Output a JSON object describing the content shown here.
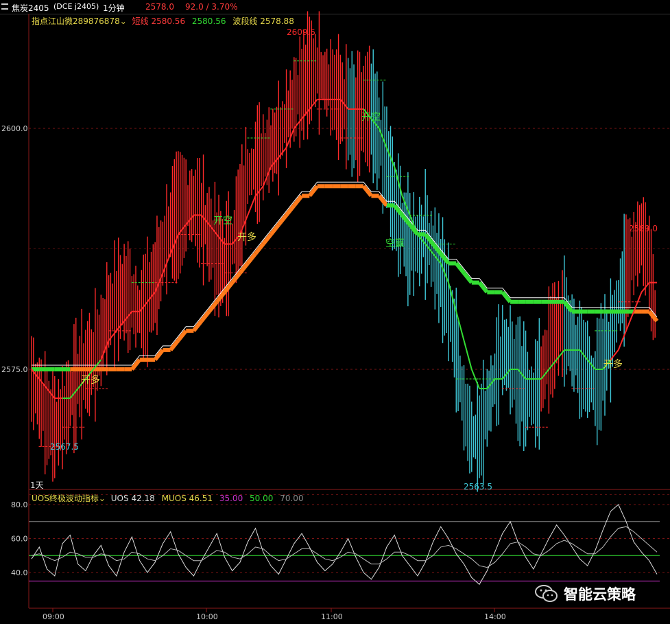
{
  "topbar": {
    "symbol": "焦炭2405",
    "symbol_code": "(DCE j2405)",
    "period": "1分钟",
    "last_price": "2578.0",
    "change": "92.0 / 3.70%"
  },
  "main_legend": {
    "indicator": "指点江山微289876878",
    "short_label": "短线",
    "short_value": "2580.56",
    "mid_value": "2580.56",
    "wave_label": "波段线",
    "wave_value": "2578.88"
  },
  "sub_legend": {
    "indicator": "UOS终极波动指标",
    "uos_label": "UOS",
    "uos_value": "42.18",
    "muos_label": "MUOS",
    "muos_value": "46.51",
    "lvl1": "35.00",
    "lvl2": "50.00",
    "lvl3": "70.00"
  },
  "period_mark": "1天",
  "watermark": "智能云策略",
  "colors": {
    "up": "#ff2a2a",
    "down": "#3fc8d8",
    "green": "#33dd33",
    "orange": "#ff7a1a",
    "white": "#ffffff",
    "grid": "#8b1a1a",
    "magenta": "#cc33cc",
    "yellow": "#e6d84a"
  },
  "signals": [
    {
      "label": "开多",
      "side": "long"
    },
    {
      "label": "开空",
      "side": "short"
    },
    {
      "label": "开多",
      "side": "long"
    },
    {
      "label": "开空",
      "side": "short"
    },
    {
      "label": "空赢",
      "side": "short"
    },
    {
      "label": "开多",
      "side": "long"
    }
  ],
  "chart_data": [
    {
      "type": "line",
      "title": "焦炭2405 1分钟",
      "xlabel": "",
      "ylabel": "",
      "x_ticks": [
        "09:00",
        "10:00",
        "11:00",
        "14:00"
      ],
      "y_ticks": [
        2575.0,
        2600.0
      ],
      "ylim": [
        2560,
        2612
      ],
      "annotations": {
        "high": "2609.5",
        "low": "2563.5",
        "left_low": "2567.5",
        "right_high": "2589.0"
      },
      "series": [
        {
          "name": "price_close",
          "values": [
            2574,
            2572,
            2570,
            2569,
            2570,
            2572,
            2574,
            2575,
            2576,
            2578,
            2581,
            2582,
            2583,
            2582,
            2581,
            2582,
            2584,
            2587,
            2590,
            2591,
            2592,
            2592,
            2591,
            2589,
            2587,
            2586,
            2588,
            2591,
            2595,
            2596,
            2597,
            2598,
            2599,
            2601,
            2603,
            2604,
            2606,
            2606,
            2605,
            2604,
            2603,
            2602,
            2601,
            2602,
            2602,
            2599,
            2597,
            2592,
            2590,
            2588,
            2588,
            2589,
            2587,
            2585,
            2582,
            2577,
            2571,
            2568,
            2568,
            2571,
            2574,
            2577,
            2576,
            2574,
            2573,
            2572,
            2574,
            2577,
            2579,
            2580,
            2578,
            2576,
            2575,
            2573,
            2576,
            2578,
            2582,
            2585,
            2587,
            2589,
            2586,
            2579
          ]
        },
        {
          "name": "短线",
          "values": [
            2575,
            2574,
            2573,
            2572,
            2572,
            2572,
            2573,
            2574,
            2575,
            2576,
            2578,
            2579,
            2580,
            2581,
            2581,
            2582,
            2583,
            2585,
            2587,
            2589,
            2590,
            2591,
            2591,
            2590,
            2589,
            2588,
            2588,
            2589,
            2591,
            2593,
            2594,
            2596,
            2597,
            2598,
            2600,
            2601,
            2602,
            2603,
            2603,
            2603,
            2603,
            2602,
            2602,
            2602,
            2601,
            2600,
            2598,
            2596,
            2593,
            2591,
            2589,
            2588,
            2587,
            2586,
            2584,
            2581,
            2578,
            2575,
            2573,
            2573,
            2574,
            2574,
            2575,
            2575,
            2574,
            2574,
            2574,
            2575,
            2576,
            2577,
            2577,
            2577,
            2576,
            2575,
            2575,
            2576,
            2577,
            2579,
            2581,
            2583,
            2584,
            2584
          ]
        },
        {
          "name": "波段线",
          "values": [
            2575,
            2575,
            2575,
            2575,
            2575,
            2575,
            2575,
            2575,
            2575,
            2575,
            2575,
            2575,
            2575,
            2575,
            2576,
            2576,
            2576,
            2577,
            2577,
            2578,
            2579,
            2579,
            2580,
            2581,
            2582,
            2583,
            2584,
            2585,
            2586,
            2587,
            2588,
            2589,
            2590,
            2591,
            2592,
            2593,
            2593,
            2594,
            2594,
            2594,
            2594,
            2594,
            2594,
            2594,
            2593,
            2593,
            2592,
            2592,
            2591,
            2590,
            2589,
            2589,
            2588,
            2587,
            2586,
            2586,
            2585,
            2584,
            2584,
            2583,
            2583,
            2583,
            2582,
            2582,
            2582,
            2582,
            2582,
            2582,
            2582,
            2582,
            2581,
            2581,
            2581,
            2581,
            2581,
            2581,
            2581,
            2581,
            2581,
            2581,
            2581,
            2580
          ]
        }
      ]
    },
    {
      "type": "line",
      "title": "UOS终极波动指标",
      "y_ticks": [
        40.0,
        60.0,
        80.0
      ],
      "ylim": [
        20,
        82
      ],
      "reference_lines": [
        35,
        50,
        70
      ],
      "series": [
        {
          "name": "UOS",
          "values": [
            48,
            55,
            42,
            38,
            57,
            62,
            45,
            41,
            50,
            56,
            44,
            38,
            52,
            61,
            47,
            40,
            46,
            57,
            64,
            51,
            43,
            38,
            47,
            55,
            63,
            49,
            41,
            46,
            58,
            66,
            52,
            44,
            39,
            48,
            57,
            63,
            55,
            46,
            41,
            45,
            52,
            60,
            49,
            40,
            36,
            43,
            55,
            62,
            50,
            44,
            38,
            46,
            58,
            67,
            60,
            51,
            45,
            37,
            33,
            41,
            52,
            63,
            70,
            58,
            49,
            42,
            51,
            60,
            68,
            62,
            55,
            48,
            44,
            53,
            65,
            76,
            80,
            70,
            58,
            52,
            47,
            39
          ]
        },
        {
          "name": "MUOS",
          "values": [
            50,
            51,
            49,
            47,
            49,
            52,
            51,
            49,
            49,
            51,
            50,
            47,
            48,
            52,
            51,
            48,
            47,
            50,
            54,
            53,
            50,
            47,
            47,
            50,
            53,
            52,
            49,
            48,
            51,
            55,
            54,
            50,
            47,
            48,
            51,
            54,
            54,
            51,
            48,
            47,
            49,
            52,
            51,
            48,
            45,
            45,
            48,
            52,
            52,
            50,
            47,
            47,
            50,
            55,
            56,
            54,
            51,
            48,
            44,
            43,
            46,
            51,
            57,
            58,
            55,
            51,
            50,
            53,
            57,
            59,
            57,
            54,
            51,
            51,
            55,
            61,
            66,
            67,
            64,
            60,
            56,
            52
          ]
        }
      ]
    }
  ]
}
